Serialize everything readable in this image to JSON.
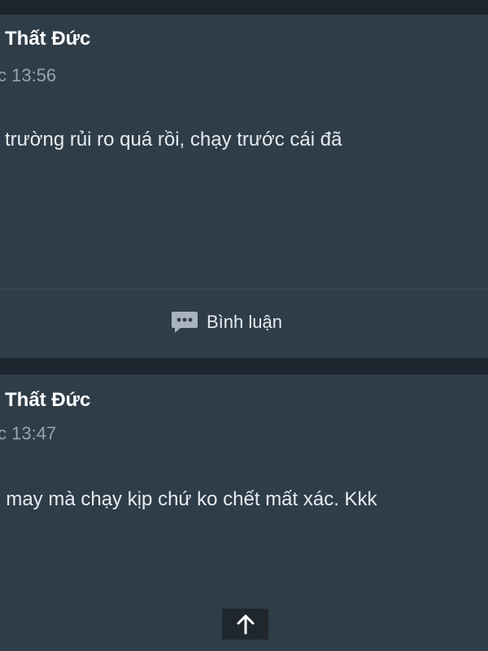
{
  "posts": [
    {
      "author": "Thất Đức",
      "timestamp": "c 13:56",
      "content": "ị trường rủi ro quá rồi, chạy trước cái đã",
      "actions": {
        "comment_label": "Bình luận",
        "comment_icon": "comment-icon"
      }
    },
    {
      "author": "Thất Đức",
      "timestamp": "c 13:47",
      "content": ", may mà chạy kịp chứ ko chết mất xác. Kkk"
    }
  ],
  "scroll_top": {
    "icon": "arrow-up-icon"
  },
  "colors": {
    "background": "#1c252e",
    "card": "#2f3d49",
    "text_primary": "#ffffff",
    "text_secondary": "#98a3ad",
    "icon": "#a8b3bd"
  }
}
